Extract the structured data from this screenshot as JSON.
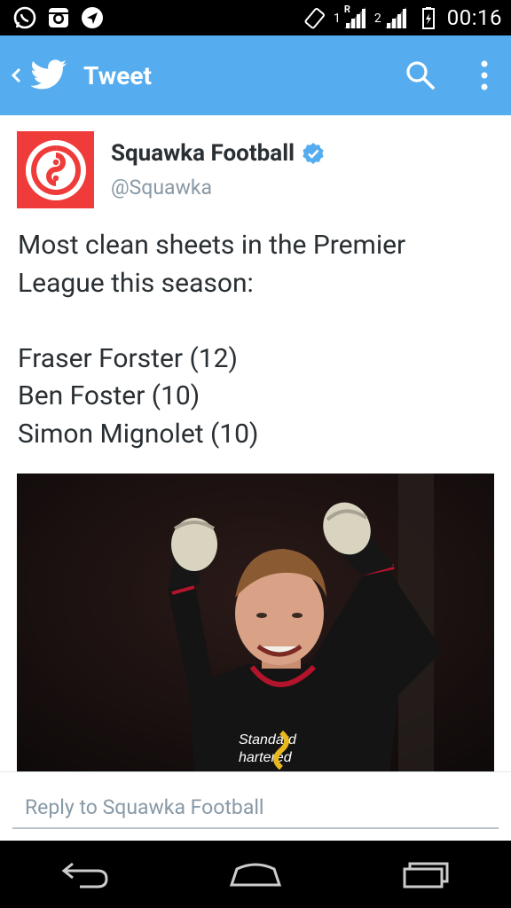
{
  "status_bar": {
    "time": "00:16",
    "sim1_label": "1",
    "sim1_roaming": "R",
    "sim2_label": "2",
    "icons": [
      "whatsapp-icon",
      "instagram-icon",
      "navigation-icon",
      "vibrate-icon",
      "signal-icon",
      "signal-icon",
      "battery-icon"
    ]
  },
  "app_bar": {
    "title": "Tweet",
    "background": "#55acee"
  },
  "tweet": {
    "display_name": "Squawka Football",
    "handle": "@Squawka",
    "verified": true,
    "avatar_color": "#ef3b39",
    "text_lines": [
      "Most clean sheets in the Premier",
      "League this season:",
      "",
      "Fraser Forster (12)",
      "Ben Foster (10)",
      "Simon Mignolet (10)"
    ],
    "photo": {
      "shirt_sponsor_line1": "Standard",
      "shirt_sponsor_line2": "hartered"
    }
  },
  "reply": {
    "placeholder": "Reply to Squawka Football"
  },
  "nav_bar": {
    "buttons": [
      "back-icon",
      "home-icon",
      "recent-apps-icon"
    ]
  }
}
